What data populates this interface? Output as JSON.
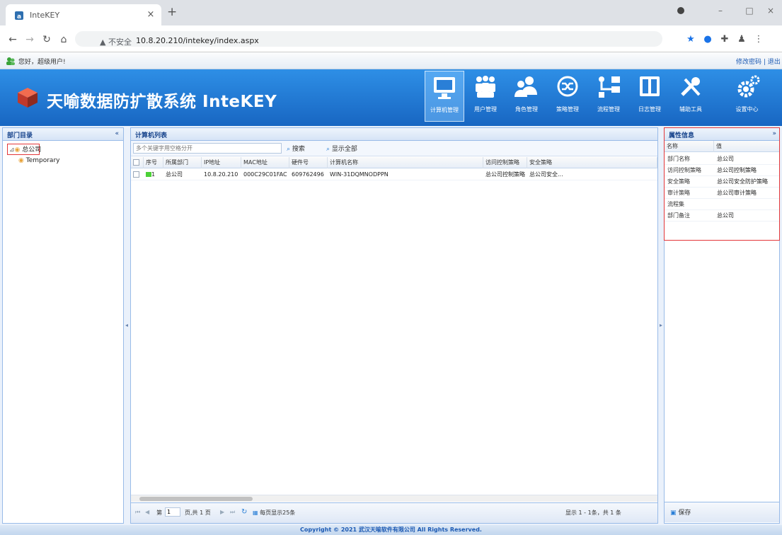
{
  "browser": {
    "tab_title": "InteKEY",
    "tab_close": "×",
    "new_tab": "+",
    "url_warning": "▲ 不安全",
    "url": "10.8.20.210/intekey/index.aspx",
    "window_controls": [
      "–",
      "□",
      "×"
    ]
  },
  "infobar": {
    "greeting": "您好，超级用户!",
    "right_links": "修改密码 | 退出"
  },
  "header": {
    "app_title": "天喻数据防扩散系统 InteKEY",
    "nav": [
      {
        "label": "计算机管理",
        "icon": "monitor-icon"
      },
      {
        "label": "用户管理",
        "icon": "users-group-icon"
      },
      {
        "label": "角色管理",
        "icon": "roles-icon"
      },
      {
        "label": "策略管理",
        "icon": "strategy-icon"
      },
      {
        "label": "流程管理",
        "icon": "workflow-icon"
      },
      {
        "label": "日志管理",
        "icon": "log-book-icon"
      },
      {
        "label": "辅助工具",
        "icon": "tools-icon"
      },
      {
        "label": "设置中心",
        "icon": "settings-gear-icon"
      }
    ],
    "active_nav": "计算机管理"
  },
  "left_panel": {
    "title": "部门目录",
    "tree": [
      {
        "label": "总公司",
        "level": 0,
        "selected": true
      },
      {
        "label": "Temporary",
        "level": 1,
        "selected": false
      }
    ]
  },
  "center_panel": {
    "title": "计算机列表",
    "search_placeholder": "多个关键字用空格分开",
    "search_button": "搜索",
    "show_all_button": "显示全部",
    "columns": [
      "序号",
      "所属部门",
      "IP地址",
      "MAC地址",
      "硬件号",
      "计算机名称",
      "访问控制策略",
      "安全策略"
    ],
    "rows": [
      {
        "index": "1",
        "dept": "总公司",
        "ip": "10.8.20.210",
        "mac": "000C29C01FAC",
        "hwid": "609762496",
        "name": "WIN-31DQMNODPPN",
        "access_policy": "总公司控制策略",
        "security_policy": "总公司安全..."
      }
    ],
    "pager": {
      "page_label": "第",
      "page_value": "1",
      "page_total": "页,共 1 页",
      "per_page": "每页显示25条",
      "display_info": "显示 1 - 1条，共 1 条"
    }
  },
  "right_panel": {
    "title": "属性信息",
    "col_name": "名称",
    "col_value": "值",
    "props": [
      {
        "k": "部门名称",
        "v": "总公司"
      },
      {
        "k": "访问控制策略",
        "v": "总公司控制策略"
      },
      {
        "k": "安全策略",
        "v": "总公司安全防护策略"
      },
      {
        "k": "审计策略",
        "v": "总公司审计策略"
      },
      {
        "k": "流程集",
        "v": ""
      },
      {
        "k": "部门备注",
        "v": "总公司"
      }
    ],
    "save_button": "保存"
  },
  "footer": {
    "copyright": "Copyright © 2021 武汉天喻软件有限公司 All Rights Reserved."
  },
  "colors": {
    "banner_top": "#2e8fe6",
    "banner_bottom": "#1866c2",
    "panel_border": "#99bbe8",
    "highlight_red": "#e3373a",
    "online_status": "#4cd137"
  }
}
